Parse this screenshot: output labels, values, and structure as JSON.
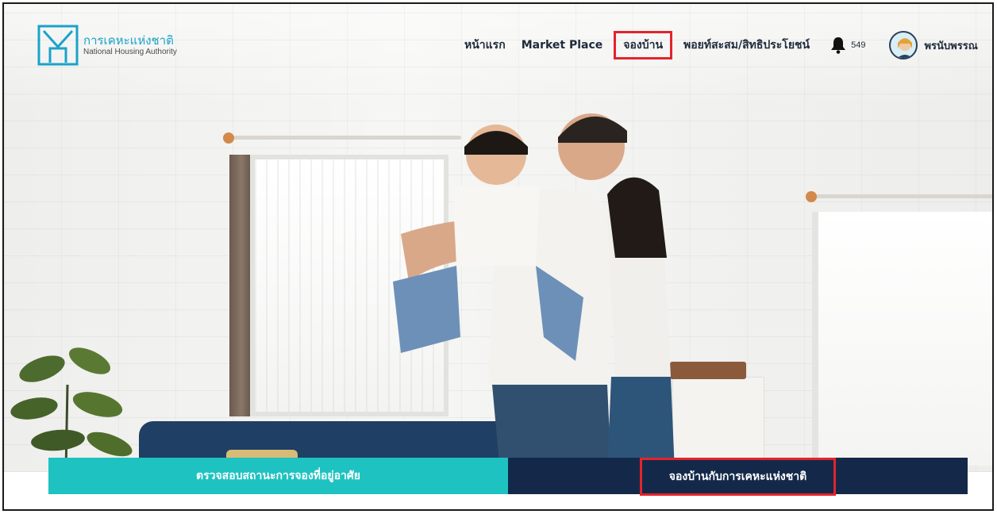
{
  "brand": {
    "name_th": "การเคหะแห่งชาติ",
    "name_en": "National Housing Authority",
    "logo_color": "#1aa3c9"
  },
  "nav": {
    "items": [
      {
        "label": "หน้าแรก",
        "highlighted": false
      },
      {
        "label": "Market Place",
        "highlighted": false
      },
      {
        "label": "จองบ้าน",
        "highlighted": true
      },
      {
        "label": "พอยท์สะสม/สิทธิประโยชน์",
        "highlighted": false
      }
    ],
    "notifications": {
      "icon": "bell-icon",
      "count": "549"
    },
    "user": {
      "icon": "avatar",
      "name": "พรนับพรรณ"
    }
  },
  "actions": {
    "check_status": {
      "label": "ตรวจสอบสถานะการจองที่อยู่อาศัย",
      "color": "#1ec2c0"
    },
    "book_house": {
      "label": "จองบ้านกับการเคหะแห่งชาติ",
      "color": "#14294a",
      "highlighted": true
    }
  },
  "colors": {
    "highlight_border": "#e3242b",
    "nav_text": "#1f2a3a"
  }
}
